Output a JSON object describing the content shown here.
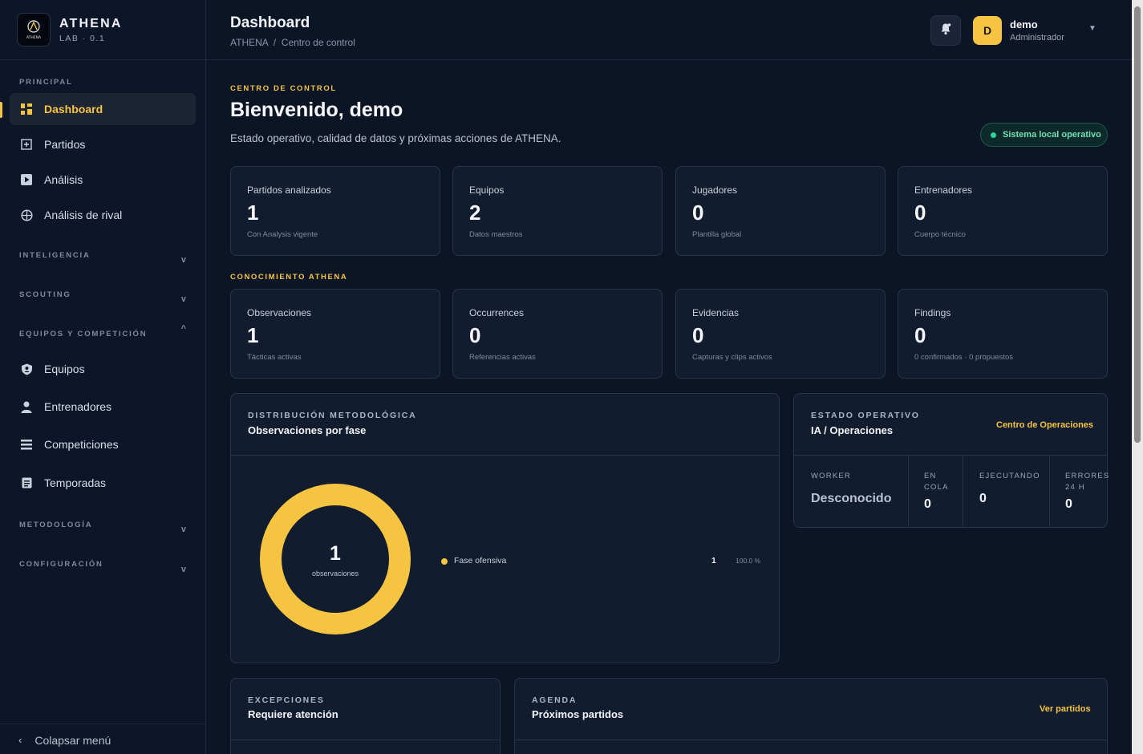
{
  "brand": {
    "name": "ATHENA",
    "sub": "LAB · 0.1",
    "logo_text": "ATHENA"
  },
  "sidebar": {
    "sections": [
      {
        "label": "PRINCIPAL"
      },
      {
        "label": "INTELIGENCIA",
        "chevron": "v"
      },
      {
        "label": "SCOUTING",
        "chevron": "v"
      },
      {
        "label": "EQUIPOS Y COMPETICIÓN",
        "chevron": "^"
      },
      {
        "label": "METODOLOGÍA",
        "chevron": "v"
      },
      {
        "label": "CONFIGURACIÓN",
        "chevron": "v"
      }
    ],
    "items": [
      {
        "label": "Dashboard",
        "icon": "grid-icon",
        "active": true
      },
      {
        "label": "Partidos",
        "icon": "plus-square-icon"
      },
      {
        "label": "Análisis",
        "icon": "play-icon"
      },
      {
        "label": "Análisis de rival",
        "icon": "target-icon"
      },
      {
        "label": "Equipos",
        "icon": "shield-icon"
      },
      {
        "label": "Entrenadores",
        "icon": "user-icon"
      },
      {
        "label": "Competiciones",
        "icon": "list-icon"
      },
      {
        "label": "Temporadas",
        "icon": "calendar-icon"
      }
    ],
    "collapse_label": "Colapsar menú"
  },
  "header": {
    "title": "Dashboard",
    "breadcrumb": "ATHENA  /  Centro de control",
    "user": {
      "initial": "D",
      "name": "demo",
      "role": "Administrador"
    }
  },
  "main": {
    "eyebrow": "CENTRO DE CONTROL",
    "welcome": "Bienvenido, demo",
    "intro": "Estado operativo, calidad de datos y próximas acciones de ATHENA.",
    "status_pill": "Sistema local operativo",
    "stats": [
      {
        "label": "Partidos analizados",
        "value": "1",
        "sub": "Con Analysis vigente"
      },
      {
        "label": "Equipos",
        "value": "2",
        "sub": "Datos maestros"
      },
      {
        "label": "Jugadores",
        "value": "0",
        "sub": "Plantilla global"
      },
      {
        "label": "Entrenadores",
        "value": "0",
        "sub": "Cuerpo técnico"
      }
    ],
    "knowledge_eyebrow": "CONOCIMIENTO ATHENA",
    "knowledge": [
      {
        "label": "Observaciones",
        "value": "1",
        "sub": "Tácticas activas"
      },
      {
        "label": "Occurrences",
        "value": "0",
        "sub": "Referencias activas"
      },
      {
        "label": "Evidencias",
        "value": "0",
        "sub": "Capturas y clips activos"
      },
      {
        "label": "Findings",
        "value": "0",
        "sub": "0 confirmados · 0 propuestos"
      }
    ],
    "distribution": {
      "eyebrow": "DISTRIBUCIÓN METODOLÓGICA",
      "title": "Observaciones por fase",
      "total": "1",
      "total_label": "observaciones",
      "legend": [
        {
          "name": "Fase ofensiva",
          "count": "1",
          "pct": "100.0 %",
          "share": 1.0,
          "color": "#f5c542"
        }
      ]
    },
    "operational": {
      "eyebrow": "ESTADO OPERATIVO",
      "title": "IA / Operaciones",
      "link": "Centro de Operaciones",
      "cols": [
        {
          "label": "WORKER",
          "value": "Desconocido"
        },
        {
          "label": "EN COLA",
          "value": "0"
        },
        {
          "label": "EJECUTANDO",
          "value": "0"
        },
        {
          "label": "ERRORES 24 H",
          "value": "0"
        }
      ]
    },
    "exceptions": {
      "eyebrow": "EXCEPCIONES",
      "title": "Requiere atención"
    },
    "agenda": {
      "eyebrow": "AGENDA",
      "title": "Próximos partidos",
      "link": "Ver partidos"
    }
  }
}
